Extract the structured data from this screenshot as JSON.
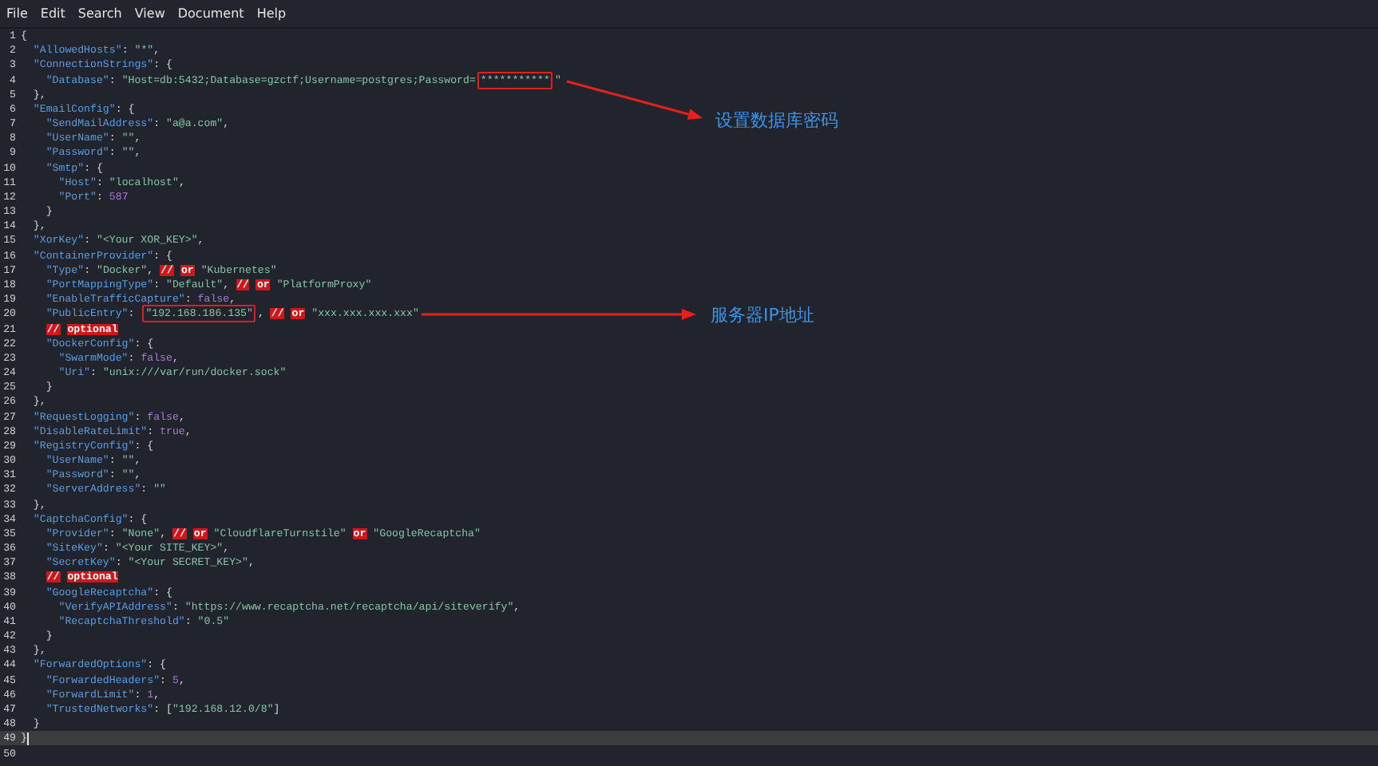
{
  "menu": [
    {
      "label": "File"
    },
    {
      "label": "Edit"
    },
    {
      "label": "Search"
    },
    {
      "label": "View"
    },
    {
      "label": "Document"
    },
    {
      "label": "Help"
    }
  ],
  "lines": [
    {
      "number": "1",
      "tokens": [
        {
          "kind": "punct",
          "text": "{"
        }
      ]
    },
    {
      "number": "2",
      "tokens": [
        {
          "kind": "key",
          "text": "\"AllowedHosts\""
        },
        {
          "kind": "punct",
          "text": ": "
        },
        {
          "kind": "str",
          "text": "\"*\""
        },
        {
          "kind": "punct",
          "text": ","
        }
      ]
    },
    {
      "number": "3",
      "tokens": [
        {
          "kind": "key",
          "text": "\"ConnectionStrings\""
        },
        {
          "kind": "punct",
          "text": ": {"
        }
      ]
    },
    {
      "number": "4",
      "tokens": [
        {
          "kind": "key",
          "text": "\"Database\""
        },
        {
          "kind": "punct",
          "text": ": "
        },
        {
          "kind": "str",
          "text": "\"Host=db:5432;Database=gzctf;Username=postgres;Password="
        },
        {
          "kind": "str",
          "text": "***********",
          "boxed": true
        },
        {
          "kind": "str",
          "text": "\""
        }
      ]
    },
    {
      "number": "5",
      "tokens": [
        {
          "kind": "punct",
          "text": "},"
        }
      ]
    },
    {
      "number": "6",
      "tokens": [
        {
          "kind": "key",
          "text": "\"EmailConfig\""
        },
        {
          "kind": "punct",
          "text": ": {"
        }
      ]
    },
    {
      "number": "7",
      "tokens": [
        {
          "kind": "key",
          "text": "\"SendMailAddress\""
        },
        {
          "kind": "punct",
          "text": ": "
        },
        {
          "kind": "str",
          "text": "\"a@a.com\""
        },
        {
          "kind": "punct",
          "text": ","
        }
      ]
    },
    {
      "number": "8",
      "tokens": [
        {
          "kind": "key",
          "text": "\"UserName\""
        },
        {
          "kind": "punct",
          "text": ": "
        },
        {
          "kind": "str",
          "text": "\"\""
        },
        {
          "kind": "punct",
          "text": ","
        }
      ]
    },
    {
      "number": "9",
      "tokens": [
        {
          "kind": "key",
          "text": "\"Password\""
        },
        {
          "kind": "punct",
          "text": ": "
        },
        {
          "kind": "str",
          "text": "\"\""
        },
        {
          "kind": "punct",
          "text": ","
        }
      ]
    },
    {
      "number": "10",
      "tokens": [
        {
          "kind": "key",
          "text": "\"Smtp\""
        },
        {
          "kind": "punct",
          "text": ": {"
        }
      ]
    },
    {
      "number": "11",
      "tokens": [
        {
          "kind": "key",
          "text": "\"Host\""
        },
        {
          "kind": "punct",
          "text": ": "
        },
        {
          "kind": "str",
          "text": "\"localhost\""
        },
        {
          "kind": "punct",
          "text": ","
        }
      ]
    },
    {
      "number": "12",
      "tokens": [
        {
          "kind": "key",
          "text": "\"Port\""
        },
        {
          "kind": "punct",
          "text": ": "
        },
        {
          "kind": "num",
          "text": "587"
        }
      ]
    },
    {
      "number": "13",
      "tokens": [
        {
          "kind": "punct",
          "text": "}"
        }
      ]
    },
    {
      "number": "14",
      "tokens": [
        {
          "kind": "punct",
          "text": "},"
        }
      ]
    },
    {
      "number": "15",
      "tokens": [
        {
          "kind": "key",
          "text": "\"XorKey\""
        },
        {
          "kind": "punct",
          "text": ": "
        },
        {
          "kind": "str",
          "text": "\"<Your XOR_KEY>\""
        },
        {
          "kind": "punct",
          "text": ","
        }
      ]
    },
    {
      "number": "16",
      "tokens": [
        {
          "kind": "key",
          "text": "\"ContainerProvider\""
        },
        {
          "kind": "punct",
          "text": ": {"
        }
      ]
    },
    {
      "number": "17",
      "tokens": [
        {
          "kind": "key",
          "text": "\"Type\""
        },
        {
          "kind": "punct",
          "text": ": "
        },
        {
          "kind": "str",
          "text": "\"Docker\""
        },
        {
          "kind": "punct",
          "text": ", "
        },
        {
          "kind": "mark",
          "text": "//"
        },
        {
          "kind": "mark",
          "text": "or"
        },
        {
          "kind": "str",
          "text": "\"Kubernetes\""
        }
      ]
    },
    {
      "number": "18",
      "tokens": [
        {
          "kind": "key",
          "text": "\"PortMappingType\""
        },
        {
          "kind": "punct",
          "text": ": "
        },
        {
          "kind": "str",
          "text": "\"Default\""
        },
        {
          "kind": "punct",
          "text": ", "
        },
        {
          "kind": "mark",
          "text": "//"
        },
        {
          "kind": "mark",
          "text": "or"
        },
        {
          "kind": "str",
          "text": "\"PlatformProxy\""
        }
      ]
    },
    {
      "number": "19",
      "tokens": [
        {
          "kind": "key",
          "text": "\"EnableTrafficCapture\""
        },
        {
          "kind": "punct",
          "text": ": "
        },
        {
          "kind": "bool",
          "text": "false"
        },
        {
          "kind": "punct",
          "text": ","
        }
      ]
    },
    {
      "number": "20",
      "tokens": [
        {
          "kind": "key",
          "text": "\"PublicEntry\""
        },
        {
          "kind": "punct",
          "text": ": "
        },
        {
          "kind": "str",
          "text": "\"192.168.186.135\"",
          "boxed": true
        },
        {
          "kind": "punct",
          "text": ", "
        },
        {
          "kind": "mark",
          "text": "//"
        },
        {
          "kind": "mark",
          "text": "or"
        },
        {
          "kind": "str",
          "text": "\"xxx.xxx.xxx.xxx\""
        }
      ]
    },
    {
      "number": "21",
      "tokens": [
        {
          "kind": "mark",
          "text": "//"
        },
        {
          "kind": "mark",
          "text": "optional"
        }
      ]
    },
    {
      "number": "22",
      "tokens": [
        {
          "kind": "key",
          "text": "\"DockerConfig\""
        },
        {
          "kind": "punct",
          "text": ": {"
        }
      ]
    },
    {
      "number": "23",
      "tokens": [
        {
          "kind": "key",
          "text": "\"SwarmMode\""
        },
        {
          "kind": "punct",
          "text": ": "
        },
        {
          "kind": "bool",
          "text": "false"
        },
        {
          "kind": "punct",
          "text": ","
        }
      ]
    },
    {
      "number": "24",
      "tokens": [
        {
          "kind": "key",
          "text": "\"Uri\""
        },
        {
          "kind": "punct",
          "text": ": "
        },
        {
          "kind": "str",
          "text": "\"unix:///var/run/docker.sock\""
        }
      ]
    },
    {
      "number": "25",
      "tokens": [
        {
          "kind": "punct",
          "text": "}"
        }
      ]
    },
    {
      "number": "26",
      "tokens": [
        {
          "kind": "punct",
          "text": "},"
        }
      ]
    },
    {
      "number": "27",
      "tokens": [
        {
          "kind": "key",
          "text": "\"RequestLogging\""
        },
        {
          "kind": "punct",
          "text": ": "
        },
        {
          "kind": "bool",
          "text": "false"
        },
        {
          "kind": "punct",
          "text": ","
        }
      ]
    },
    {
      "number": "28",
      "tokens": [
        {
          "kind": "key",
          "text": "\"DisableRateLimit\""
        },
        {
          "kind": "punct",
          "text": ": "
        },
        {
          "kind": "bool",
          "text": "true"
        },
        {
          "kind": "punct",
          "text": ","
        }
      ]
    },
    {
      "number": "29",
      "tokens": [
        {
          "kind": "key",
          "text": "\"RegistryConfig\""
        },
        {
          "kind": "punct",
          "text": ": {"
        }
      ]
    },
    {
      "number": "30",
      "tokens": [
        {
          "kind": "key",
          "text": "\"UserName\""
        },
        {
          "kind": "punct",
          "text": ": "
        },
        {
          "kind": "str",
          "text": "\"\""
        },
        {
          "kind": "punct",
          "text": ","
        }
      ]
    },
    {
      "number": "31",
      "tokens": [
        {
          "kind": "key",
          "text": "\"Password\""
        },
        {
          "kind": "punct",
          "text": ": "
        },
        {
          "kind": "str",
          "text": "\"\""
        },
        {
          "kind": "punct",
          "text": ","
        }
      ]
    },
    {
      "number": "32",
      "tokens": [
        {
          "kind": "key",
          "text": "\"ServerAddress\""
        },
        {
          "kind": "punct",
          "text": ": "
        },
        {
          "kind": "str",
          "text": "\"\""
        }
      ]
    },
    {
      "number": "33",
      "tokens": [
        {
          "kind": "punct",
          "text": "},"
        }
      ]
    },
    {
      "number": "34",
      "tokens": [
        {
          "kind": "key",
          "text": "\"CaptchaConfig\""
        },
        {
          "kind": "punct",
          "text": ": {"
        }
      ]
    },
    {
      "number": "35",
      "tokens": [
        {
          "kind": "key",
          "text": "\"Provider\""
        },
        {
          "kind": "punct",
          "text": ": "
        },
        {
          "kind": "str",
          "text": "\"None\""
        },
        {
          "kind": "punct",
          "text": ", "
        },
        {
          "kind": "mark",
          "text": "//"
        },
        {
          "kind": "mark",
          "text": "or"
        },
        {
          "kind": "str",
          "text": "\"CloudflareTurnstile\""
        },
        {
          "kind": "mark",
          "text": "or"
        },
        {
          "kind": "str",
          "text": "\"GoogleRecaptcha\""
        }
      ]
    },
    {
      "number": "36",
      "tokens": [
        {
          "kind": "key",
          "text": "\"SiteKey\""
        },
        {
          "kind": "punct",
          "text": ": "
        },
        {
          "kind": "str",
          "text": "\"<Your SITE_KEY>\""
        },
        {
          "kind": "punct",
          "text": ","
        }
      ]
    },
    {
      "number": "37",
      "tokens": [
        {
          "kind": "key",
          "text": "\"SecretKey\""
        },
        {
          "kind": "punct",
          "text": ": "
        },
        {
          "kind": "str",
          "text": "\"<Your SECRET_KEY>\""
        },
        {
          "kind": "punct",
          "text": ","
        }
      ]
    },
    {
      "number": "38",
      "tokens": [
        {
          "kind": "mark",
          "text": "//"
        },
        {
          "kind": "mark",
          "text": "optional"
        }
      ]
    },
    {
      "number": "39",
      "tokens": [
        {
          "kind": "key",
          "text": "\"GoogleRecaptcha\""
        },
        {
          "kind": "punct",
          "text": ": {"
        }
      ]
    },
    {
      "number": "40",
      "tokens": [
        {
          "kind": "key",
          "text": "\"VerifyAPIAddress\""
        },
        {
          "kind": "punct",
          "text": ": "
        },
        {
          "kind": "str",
          "text": "\"https://www.recaptcha.net/recaptcha/api/siteverify\""
        },
        {
          "kind": "punct",
          "text": ","
        }
      ]
    },
    {
      "number": "41",
      "tokens": [
        {
          "kind": "key",
          "text": "\"RecaptchaThreshold\""
        },
        {
          "kind": "punct",
          "text": ": "
        },
        {
          "kind": "str",
          "text": "\"0.5\""
        }
      ]
    },
    {
      "number": "42",
      "tokens": [
        {
          "kind": "punct",
          "text": "}"
        }
      ]
    },
    {
      "number": "43",
      "tokens": [
        {
          "kind": "punct",
          "text": "},"
        }
      ]
    },
    {
      "number": "44",
      "tokens": [
        {
          "kind": "key",
          "text": "\"ForwardedOptions\""
        },
        {
          "kind": "punct",
          "text": ": {"
        }
      ]
    },
    {
      "number": "45",
      "tokens": [
        {
          "kind": "key",
          "text": "\"ForwardedHeaders\""
        },
        {
          "kind": "punct",
          "text": ": "
        },
        {
          "kind": "num",
          "text": "5"
        },
        {
          "kind": "punct",
          "text": ","
        }
      ]
    },
    {
      "number": "46",
      "tokens": [
        {
          "kind": "key",
          "text": "\"ForwardLimit\""
        },
        {
          "kind": "punct",
          "text": ": "
        },
        {
          "kind": "num",
          "text": "1"
        },
        {
          "kind": "punct",
          "text": ","
        }
      ]
    },
    {
      "number": "47",
      "tokens": [
        {
          "kind": "key",
          "text": "\"TrustedNetworks\""
        },
        {
          "kind": "punct",
          "text": ": ["
        },
        {
          "kind": "str",
          "text": "\"192.168.12.0/8\""
        },
        {
          "kind": "punct",
          "text": "]"
        }
      ]
    },
    {
      "number": "48",
      "tokens": [
        {
          "kind": "punct",
          "text": "}"
        }
      ]
    },
    {
      "number": "49",
      "current": true,
      "tokens": [
        {
          "kind": "punct",
          "text": "}"
        }
      ]
    },
    {
      "number": "50"
    }
  ],
  "annotations": [
    {
      "text": "设置数据库密码"
    },
    {
      "text": "服务器IP地址"
    }
  ]
}
